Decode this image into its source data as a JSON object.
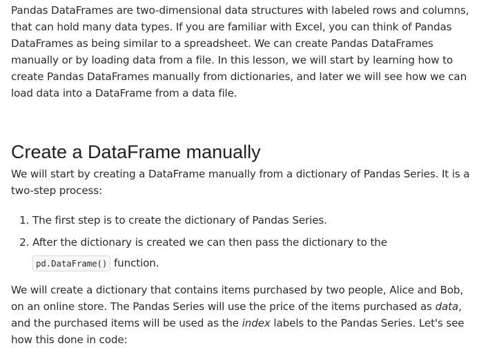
{
  "intro": "Pandas DataFrames are two-dimensional data structures with labeled rows and columns, that can hold many data types. If you are familiar with Excel, you can think of Pandas DataFrames as being similar to a spreadsheet. We can create Pandas DataFrames manually or by loading data from a file. In this lesson, we will start by learning how to create Pandas DataFrames manually from dictionaries, and later we will see how we can load data into a DataFrame from a data file.",
  "section_title": "Create a DataFrame manually",
  "lead": "We will start by creating a DataFrame manually from a dictionary of Pandas Series. It is a two-step process:",
  "steps": [
    {
      "text": "The first step is to create the dictionary of Pandas Series."
    },
    {
      "text_before": "After the dictionary is created we can then pass the dictionary to the",
      "code": "pd.DataFrame()",
      "text_after": " function."
    }
  ],
  "outro": {
    "part1": "We will create a dictionary that contains items purchased by two people, Alice and Bob, on an online store. The Pandas Series will use the price of the items purchased as ",
    "em1": "data",
    "part2": ", and the purchased items will be used as the ",
    "em2": "index",
    "part3": " labels to the Pandas Series. Let's see how this done in code:"
  }
}
